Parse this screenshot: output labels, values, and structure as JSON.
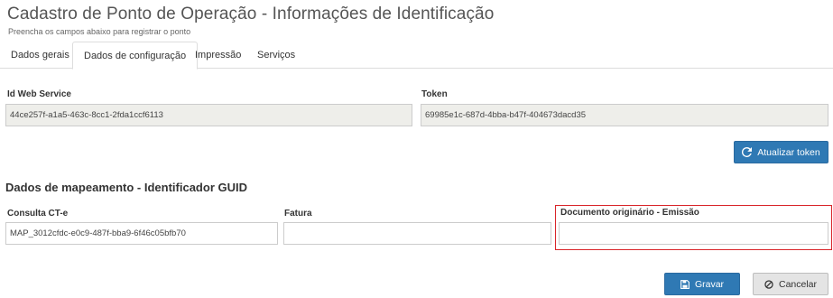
{
  "header": {
    "title": "Cadastro de Ponto de Operação - Informações de Identificação",
    "subtitle": "Preencha os campos abaixo para registrar o ponto"
  },
  "tabs": [
    {
      "label": "Dados gerais",
      "active": false
    },
    {
      "label": "Dados de configuração",
      "active": true
    },
    {
      "label": "Impressão",
      "active": false
    },
    {
      "label": "Serviços",
      "active": false
    }
  ],
  "config": {
    "id_web_service": {
      "label": "Id Web Service",
      "value": "44ce257f-a1a5-463c-8cc1-2fda1ccf6113"
    },
    "token": {
      "label": "Token",
      "value": "69985e1c-687d-4bba-b47f-404673dacd35"
    },
    "update_token_label": "Atualizar token"
  },
  "mapping": {
    "title": "Dados de mapeamento - Identificador GUID",
    "consulta_cte": {
      "label": "Consulta CT-e",
      "value": "MAP_3012cfdc-e0c9-487f-bba9-6f46c05bfb70"
    },
    "fatura": {
      "label": "Fatura",
      "value": ""
    },
    "documento_originario": {
      "label": "Documento originário - Emissão",
      "value": ""
    }
  },
  "actions": {
    "save_label": "Gravar",
    "cancel_label": "Cancelar"
  },
  "colors": {
    "primary": "#2f79b4",
    "highlight": "#d9252a"
  },
  "icons": {
    "refresh": "refresh-icon",
    "save": "save-icon",
    "cancel": "cancel-icon"
  }
}
